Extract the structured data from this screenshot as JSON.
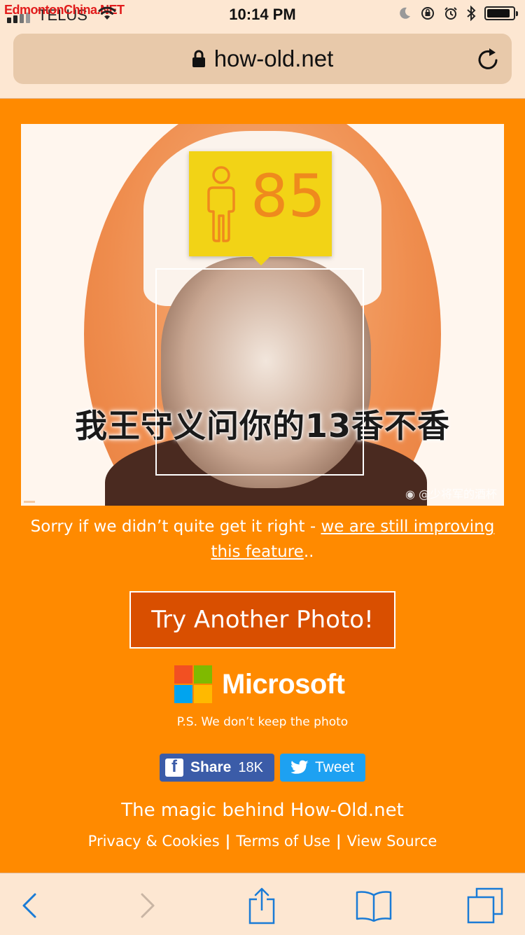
{
  "status_bar": {
    "watermark": "EdmontonChina.NET",
    "carrier": "TELUS",
    "time": "10:14 PM",
    "battery_level": 0.9
  },
  "browser": {
    "url": "how-old.net"
  },
  "result": {
    "age": "85",
    "photo_caption": "我王守义问你的13香不香",
    "photo_credit": "@少将军的酒杯"
  },
  "message": {
    "prefix": "Sorry if we didn’t quite get it right - ",
    "link": "we are still improving this feature",
    "suffix": ".."
  },
  "try_button": "Try Another Photo!",
  "brand": "Microsoft",
  "ps_note": "P.S. We don’t keep the photo",
  "share": {
    "facebook_label": "Share",
    "facebook_count": "18K",
    "twitter_label": "Tweet"
  },
  "footer": {
    "magic": "The magic behind How-Old.net",
    "links": [
      "Privacy & Cookies",
      "Terms of Use",
      "View Source"
    ]
  },
  "colors": {
    "page_bg": "#ff8a00",
    "age_tag": "#f2d316",
    "age_text": "#ef8a1d",
    "button_bg": "#d94f00",
    "facebook": "#3b5ca8",
    "twitter": "#1da1f2",
    "ios_blue": "#1a7bd6"
  },
  "icons": {
    "lock": "lock-icon",
    "reload": "reload-icon",
    "person": "person-icon",
    "back": "back-arrow-icon",
    "forward": "forward-arrow-icon",
    "share": "share-icon",
    "bookmarks": "bookmarks-icon",
    "tabs": "tabs-icon"
  }
}
